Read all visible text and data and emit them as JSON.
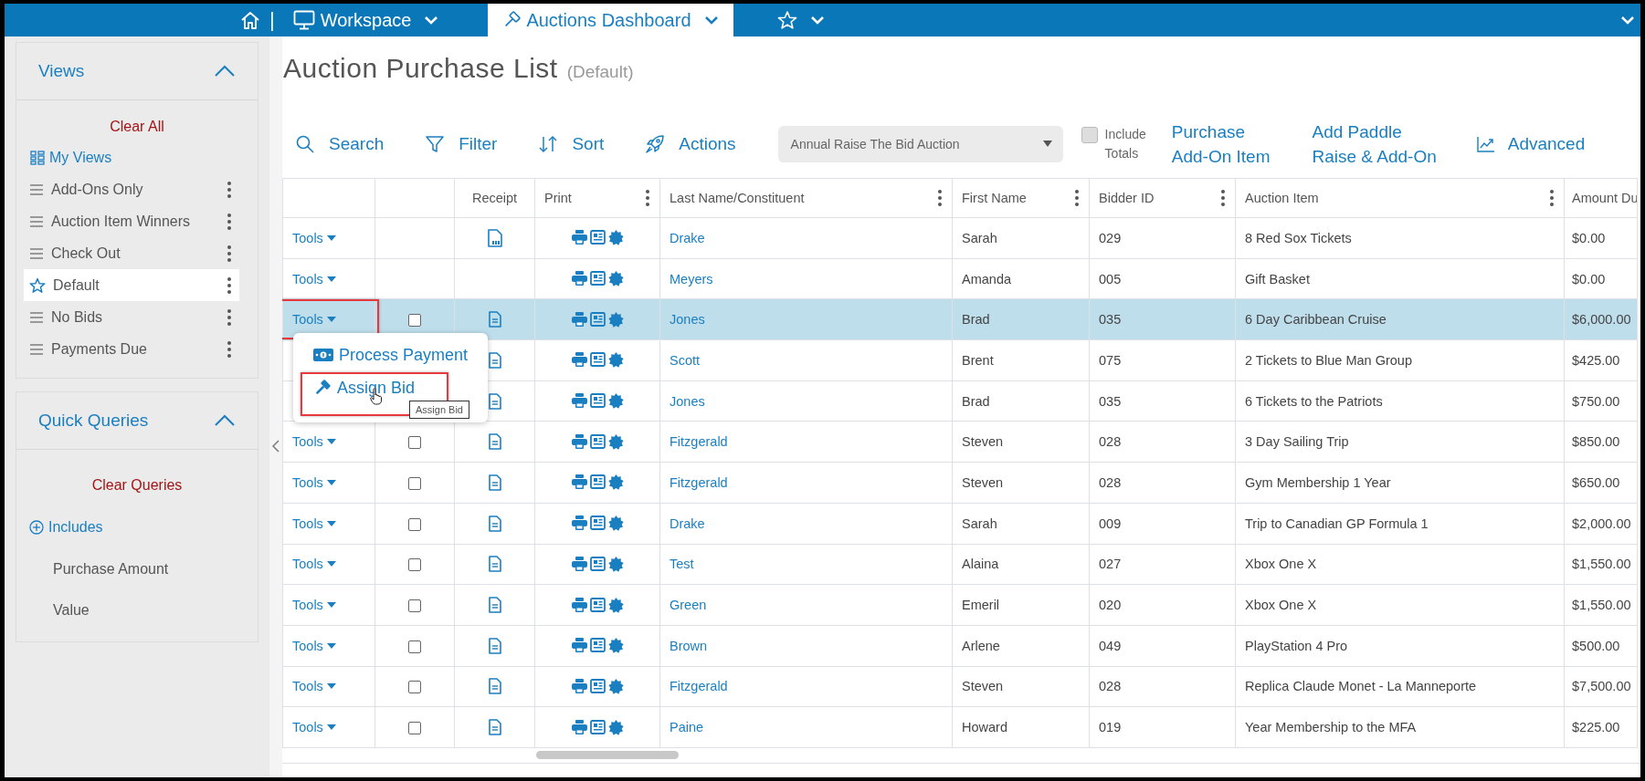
{
  "top_nav": {
    "separator": "|",
    "tabs": [
      {
        "kind": "workspace",
        "label": "Workspace",
        "selected": false
      },
      {
        "kind": "auctions",
        "label": "Auctions Dashboard",
        "selected": true
      },
      {
        "kind": "favorites",
        "selected": false
      }
    ]
  },
  "views": {
    "title": "Views",
    "expanded": true,
    "clear_label": "Clear All",
    "my_views": "My Views",
    "items": [
      {
        "label": "Add-Ons Only",
        "selected": false
      },
      {
        "label": "Auction Item Winners",
        "selected": false
      },
      {
        "label": "Check Out",
        "selected": false
      },
      {
        "label": "Default",
        "selected": true
      },
      {
        "label": "No Bids",
        "selected": false
      },
      {
        "label": "Payments Due",
        "selected": false
      }
    ]
  },
  "quick_queries": {
    "title": "Quick Queries",
    "expanded": true,
    "clear_label": "Clear Queries",
    "includes": "Includes",
    "items": [
      "Purchase Amount",
      "Value"
    ]
  },
  "page": {
    "title": "Auction Purchase List",
    "subtitle": "(Default)"
  },
  "toolbar": {
    "actions": [
      {
        "kind": "search",
        "label": "Search"
      },
      {
        "kind": "filter",
        "label": "Filter"
      },
      {
        "kind": "sort",
        "label": "Sort"
      },
      {
        "kind": "actions",
        "label": "Actions"
      }
    ],
    "auction_select": "Annual Raise The Bid Auction",
    "include_totals": {
      "lines": [
        "Include",
        "Totals"
      ],
      "checked": false
    },
    "links": [
      {
        "lines": [
          "Purchase",
          "Add-On Item"
        ]
      },
      {
        "lines": [
          "Add Paddle",
          "Raise & Add-On"
        ]
      }
    ],
    "advanced": "Advanced"
  },
  "table": {
    "columns": [
      {
        "menu": false
      },
      {
        "menu": false
      },
      {
        "label": "Receipt",
        "menu": false
      },
      {
        "label": "Print",
        "menu": true
      },
      {
        "label": "Last Name/Constituent",
        "menu": true
      },
      {
        "label": "First Name",
        "menu": true
      },
      {
        "label": "Bidder ID",
        "menu": true
      },
      {
        "label": "Auction Item",
        "menu": true
      },
      {
        "label": "Amount Du"
      }
    ],
    "rows": [
      {
        "tools": "Tools",
        "receipt": {
          "kind": "pdf"
        },
        "last_name": "Drake",
        "first_name": "Sarah",
        "bidder_id": "029",
        "auction_item": "8 Red Sox Tickets",
        "amount_due": "$0.00",
        "selected": false
      },
      {
        "tools": "Tools",
        "last_name": "Meyers",
        "first_name": "Amanda",
        "bidder_id": "005",
        "auction_item": "Gift Basket",
        "amount_due": "$0.00",
        "selected": false
      },
      {
        "tools": "Tools",
        "highlighted": true,
        "checked": false,
        "receipt": {
          "kind": "doc"
        },
        "last_name": "Jones",
        "first_name": "Brad",
        "bidder_id": "035",
        "auction_item": "6 Day Caribbean Cruise",
        "amount_due": "$6,000.00",
        "selected": true
      },
      {
        "receipt": {
          "kind": "doc"
        },
        "last_name": "Scott",
        "first_name": "Brent",
        "bidder_id": "075",
        "auction_item": "2 Tickets to Blue Man Group",
        "amount_due": "$425.00",
        "selected": false
      },
      {
        "receipt": {
          "kind": "doc"
        },
        "last_name": "Jones",
        "first_name": "Brad",
        "bidder_id": "035",
        "auction_item": "6 Tickets to the Patriots",
        "amount_due": "$750.00",
        "selected": false
      },
      {
        "tools": "Tools",
        "checked": false,
        "receipt": {
          "kind": "doc"
        },
        "last_name": "Fitzgerald",
        "first_name": "Steven",
        "bidder_id": "028",
        "auction_item": "3 Day Sailing Trip",
        "amount_due": "$850.00",
        "selected": false
      },
      {
        "tools": "Tools",
        "checked": false,
        "receipt": {
          "kind": "doc"
        },
        "last_name": "Fitzgerald",
        "first_name": "Steven",
        "bidder_id": "028",
        "auction_item": "Gym Membership 1 Year",
        "amount_due": "$650.00",
        "selected": false
      },
      {
        "tools": "Tools",
        "checked": false,
        "receipt": {
          "kind": "doc"
        },
        "last_name": "Drake",
        "first_name": "Sarah",
        "bidder_id": "009",
        "auction_item": "Trip to Canadian GP Formula 1",
        "amount_due": "$2,000.00",
        "selected": false
      },
      {
        "tools": "Tools",
        "checked": false,
        "receipt": {
          "kind": "doc"
        },
        "last_name": "Test",
        "first_name": "Alaina",
        "bidder_id": "027",
        "auction_item": "Xbox One X",
        "amount_due": "$1,550.00",
        "selected": false
      },
      {
        "tools": "Tools",
        "checked": false,
        "receipt": {
          "kind": "doc"
        },
        "last_name": "Green",
        "first_name": "Emeril",
        "bidder_id": "020",
        "auction_item": "Xbox One X",
        "amount_due": "$1,550.00",
        "selected": false
      },
      {
        "tools": "Tools",
        "checked": false,
        "receipt": {
          "kind": "doc"
        },
        "last_name": "Brown",
        "first_name": "Arlene",
        "bidder_id": "049",
        "auction_item": "PlayStation 4 Pro",
        "amount_due": "$500.00",
        "selected": false
      },
      {
        "tools": "Tools",
        "checked": false,
        "receipt": {
          "kind": "doc"
        },
        "last_name": "Fitzgerald",
        "first_name": "Steven",
        "bidder_id": "028",
        "auction_item": "Replica Claude Monet - La Manneporte",
        "amount_due": "$7,500.00",
        "selected": false
      },
      {
        "tools": "Tools",
        "checked": false,
        "receipt": {
          "kind": "doc"
        },
        "last_name": "Paine",
        "first_name": "Howard",
        "bidder_id": "019",
        "auction_item": "Year Membership to the MFA",
        "amount_due": "$225.00",
        "selected": false
      }
    ]
  },
  "tools_menu": {
    "items": [
      {
        "kind": "payment",
        "label": "Process Payment",
        "highlighted": false,
        "hovered": false
      },
      {
        "kind": "gavel",
        "label": "Assign Bid",
        "highlighted": true,
        "hovered": true
      }
    ],
    "tooltip": "Assign Bid"
  }
}
